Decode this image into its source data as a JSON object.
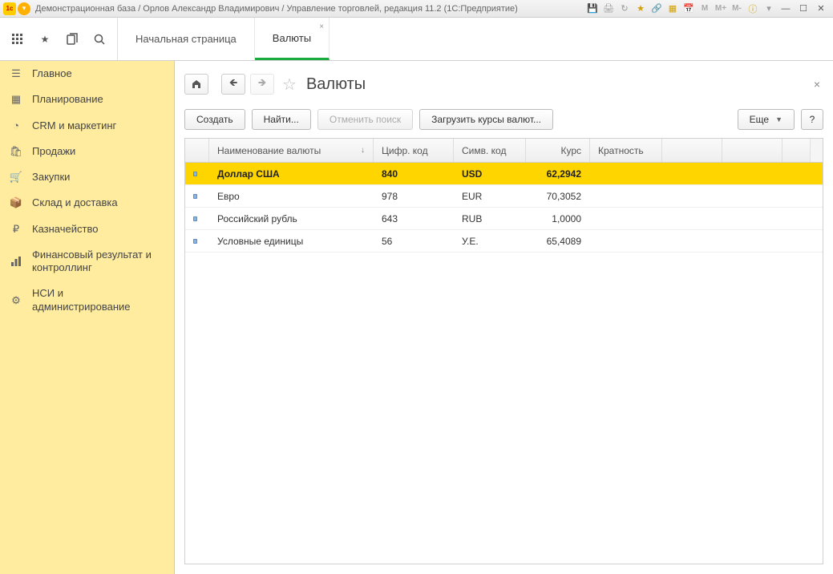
{
  "titlebar": {
    "text": "Демонстрационная база / Орлов Александр Владимирович / Управление торговлей, редакция 11.2  (1С:Предприятие)"
  },
  "tabs": {
    "home": "Начальная страница",
    "active": "Валюты"
  },
  "sidebar": {
    "items": [
      {
        "icon": "list",
        "label": "Главное"
      },
      {
        "icon": "calendar",
        "label": "Планирование"
      },
      {
        "icon": "pie",
        "label": "CRM и маркетинг"
      },
      {
        "icon": "bag",
        "label": "Продажи"
      },
      {
        "icon": "cart",
        "label": "Закупки"
      },
      {
        "icon": "box",
        "label": "Склад и доставка"
      },
      {
        "icon": "ruble",
        "label": "Казначейство"
      },
      {
        "icon": "chart",
        "label": "Финансовый результат и контроллинг"
      },
      {
        "icon": "gear",
        "label": "НСИ и администрирование"
      }
    ]
  },
  "page": {
    "title": "Валюты"
  },
  "actions": {
    "create": "Создать",
    "find": "Найти...",
    "cancel_search": "Отменить поиск",
    "load_rates": "Загрузить курсы валют...",
    "more": "Еще",
    "help": "?"
  },
  "table": {
    "headers": {
      "name": "Наименование валюты",
      "code": "Цифр. код",
      "symbol": "Симв. код",
      "rate": "Курс",
      "mult": "Кратность"
    },
    "rows": [
      {
        "name": "Доллар США",
        "code": "840",
        "symbol": "USD",
        "rate": "62,2942",
        "selected": true
      },
      {
        "name": "Евро",
        "code": "978",
        "symbol": "EUR",
        "rate": "70,3052"
      },
      {
        "name": "Российский рубль",
        "code": "643",
        "symbol": "RUB",
        "rate": "1,0000"
      },
      {
        "name": "Условные единицы",
        "code": "56",
        "symbol": "У.Е.",
        "rate": "65,4089"
      }
    ]
  }
}
